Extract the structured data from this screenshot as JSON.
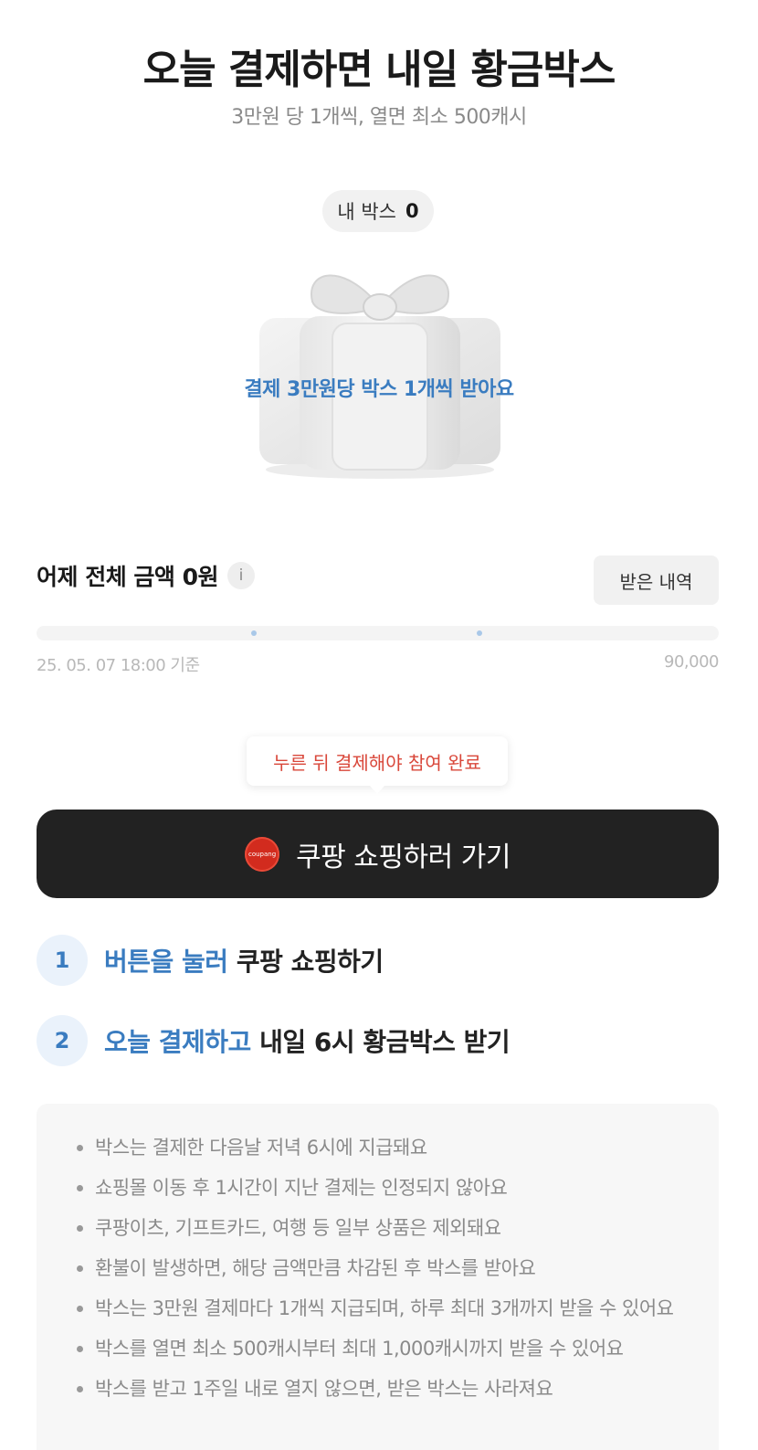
{
  "header": {
    "title": "오늘 결제하면 내일 황금박스",
    "subtitle": "3만원 당 1개씩, 열면 최소 500캐시"
  },
  "mybox": {
    "label": "내 박스",
    "count": "0"
  },
  "gift": {
    "icon": "gift-box-icon",
    "caption": "결제 3만원당 박스 1개씩 받아요"
  },
  "spending": {
    "label": "어제 전체 금액 0원",
    "info_icon": "i",
    "history_button": "받은 내역",
    "progress_fraction": 0,
    "timestamp": "25. 05. 07 18:00 기준",
    "max_label": "90,000"
  },
  "tooltip": {
    "text": "누른 뒤 결제해야 참여 완료"
  },
  "shop_button": {
    "icon_text": "coupang",
    "label": "쿠팡 쇼핑하러 가기"
  },
  "steps": [
    {
      "num": "1",
      "highlight": "버튼을 눌러",
      "rest": "쿠팡 쇼핑하기"
    },
    {
      "num": "2",
      "highlight": "오늘 결제하고",
      "rest": "내일 6시 황금박스 받기"
    }
  ],
  "notes": [
    "박스는 결제한 다음날 저녁 6시에 지급돼요",
    "쇼핑몰 이동 후 1시간이 지난 결제는 인정되지 않아요",
    "쿠팡이츠, 기프트카드, 여행 등 일부 상품은 제외돼요",
    "환불이 발생하면, 해당 금액만큼 차감된 후 박스를 받아요",
    "박스는 3만원 결제마다 1개씩 지급되며, 하루 최대 3개까지 받을 수 있어요",
    "박스를 열면 최소 500캐시부터 최대 1,000캐시까지 받을 수 있어요",
    "박스를 받고 1주일 내로 열지 않으면, 받은 박스는 사라져요"
  ],
  "colors": {
    "accent": "#3a7cc0",
    "tooltip_text": "#d9473a",
    "button_bg": "#222222"
  }
}
